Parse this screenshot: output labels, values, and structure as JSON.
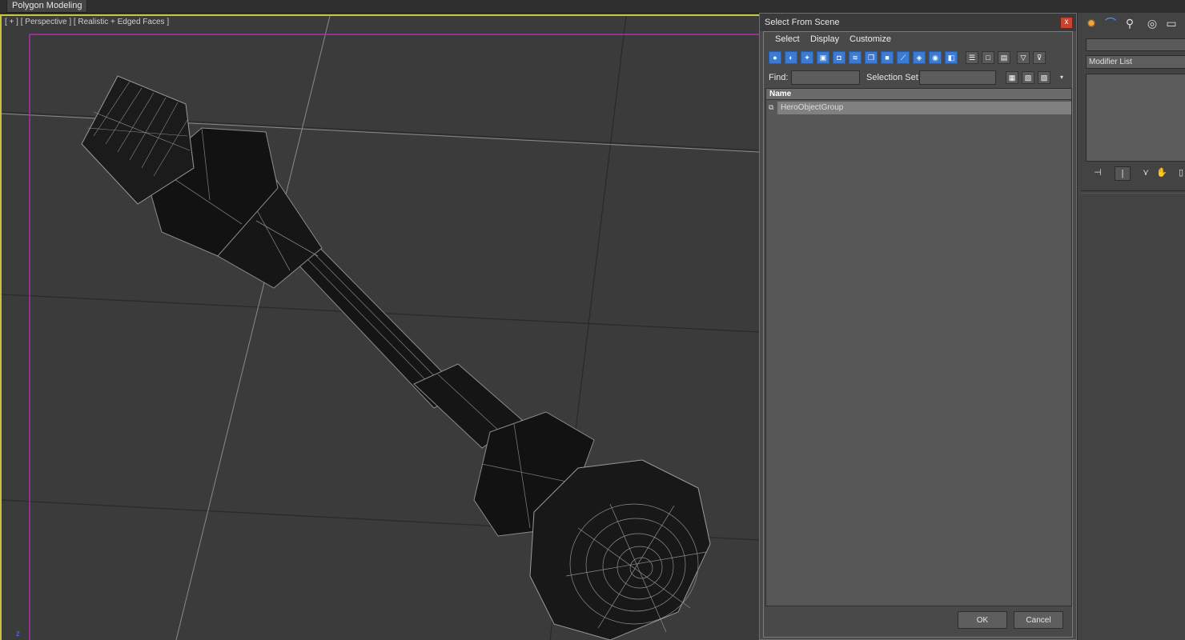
{
  "ribbon": {
    "tab_label": "Polygon Modeling"
  },
  "viewport": {
    "label": "[ + ] [ Perspective ] [ Realistic + Edged Faces ]",
    "axis_label": "z"
  },
  "dialog": {
    "title": "Select From Scene",
    "close_glyph": "x",
    "menu": [
      "Select",
      "Display",
      "Customize"
    ],
    "find_label": "Find:",
    "find_value": "",
    "selection_set_label": "Selection Set:",
    "selection_set_value": "",
    "list_header": "Name",
    "list_items": [
      "HeroObjectGroup"
    ],
    "ok_label": "OK",
    "cancel_label": "Cancel",
    "accent_color": "#3b7bd4"
  },
  "panel": {
    "modifier_list_label": "Modifier List",
    "tab_icons": [
      "sun-icon",
      "curve-icon",
      "hierarchy-icon",
      "motion-icon",
      "display-icon"
    ]
  },
  "colors": {
    "viewport_border": "#c9c23a",
    "safe_frame": "#b030b0",
    "close_button": "#c9432f"
  }
}
